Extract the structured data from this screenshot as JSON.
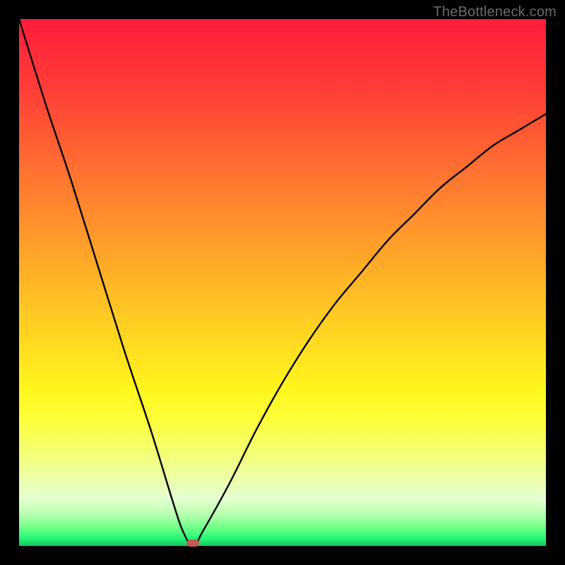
{
  "watermark": "TheBottleneck.com",
  "colors": {
    "frame": "#000000",
    "gradient_top": "#ff1c3a",
    "gradient_bottom": "#14c85e",
    "curve": "#000000",
    "marker": "#c05a52"
  },
  "chart_data": {
    "type": "line",
    "title": "",
    "xlabel": "",
    "ylabel": "",
    "xlim": [
      0,
      100
    ],
    "ylim": [
      0,
      100
    ],
    "grid": false,
    "legend": false,
    "annotations": [
      {
        "text": "TheBottleneck.com",
        "position": "top-right"
      }
    ],
    "series": [
      {
        "name": "bottleneck-curve",
        "x": [
          0,
          5,
          10,
          15,
          20,
          25,
          29,
          31,
          33,
          35,
          40,
          45,
          50,
          55,
          60,
          65,
          70,
          75,
          80,
          85,
          90,
          95,
          100
        ],
        "values": [
          100,
          84,
          69,
          53,
          37,
          22,
          9,
          3,
          0,
          3,
          12,
          22,
          31,
          39,
          46,
          52,
          58,
          63,
          68,
          72,
          76,
          79,
          82
        ]
      }
    ],
    "marker": {
      "x": 33,
      "y": 0,
      "shape": "rounded-rect"
    },
    "background_gradient": {
      "direction": "vertical",
      "stops": [
        {
          "pos": 0.0,
          "color": "#ff1c3a"
        },
        {
          "pos": 0.7,
          "color": "#fff51c"
        },
        {
          "pos": 0.94,
          "color": "#b8ffb0"
        },
        {
          "pos": 1.0,
          "color": "#14c85e"
        }
      ]
    }
  }
}
